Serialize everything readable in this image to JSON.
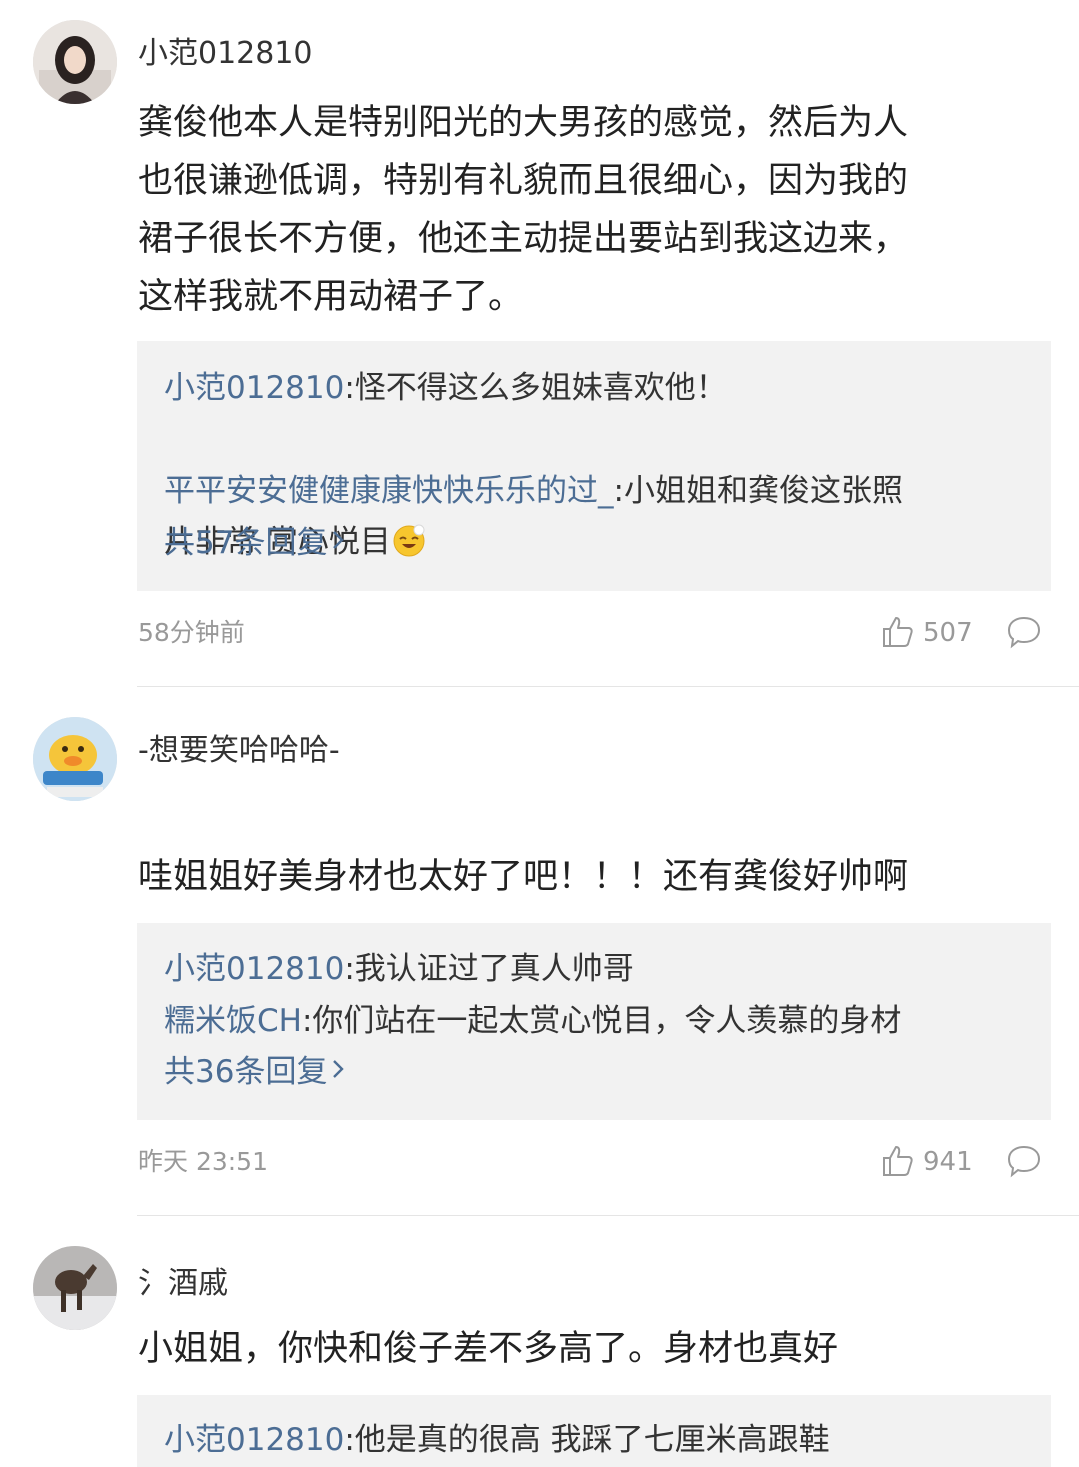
{
  "comments": [
    {
      "username": "小范012810",
      "content": "龚俊他本人是特别阳光的大男孩的感觉，然后为人\n也很谦逊低调，特别有礼貌而且很细心，因为我的\n裙子很长不方便，他还主动提出要站到我这边来，\n这样我就不用动裙子了。",
      "replies": [
        {
          "user": "小范012810",
          "text": "怪不得这么多姐妹喜欢他！"
        },
        {
          "user": "平平安安健健康康快快乐乐的过_",
          "text": "小姐姐和龚俊这张照\n片非常 赏心悦目"
        }
      ],
      "more_replies": "共57条回复",
      "time": "58分钟前",
      "likes": "507"
    },
    {
      "username": "-想要笑哈哈哈-",
      "content": "哇姐姐好美身材也太好了吧！！！还有龚俊好帅啊",
      "replies": [
        {
          "user": "小范012810",
          "text": "我认证过了真人帅哥"
        },
        {
          "user": "糯米饭CH",
          "text": "你们站在一起太赏心悦目，令人羡慕的身材"
        }
      ],
      "more_replies": "共36条回复",
      "time": "昨天 23:51",
      "likes": "941"
    },
    {
      "username": "氵酒戚",
      "content": "小姐姐，你快和俊子差不多高了。身材也真好",
      "replies": [
        {
          "user": "小范012810",
          "text": "他是真的很高 我踩了七厘米高跟鞋"
        }
      ]
    }
  ],
  "icons": {
    "like": "thumbs-up-icon",
    "comment": "speech-bubble-icon",
    "more": "chevron-right-icon"
  },
  "colors": {
    "link": "#4c6d94",
    "meta": "#999999",
    "reply_bg": "#f2f2f2"
  }
}
